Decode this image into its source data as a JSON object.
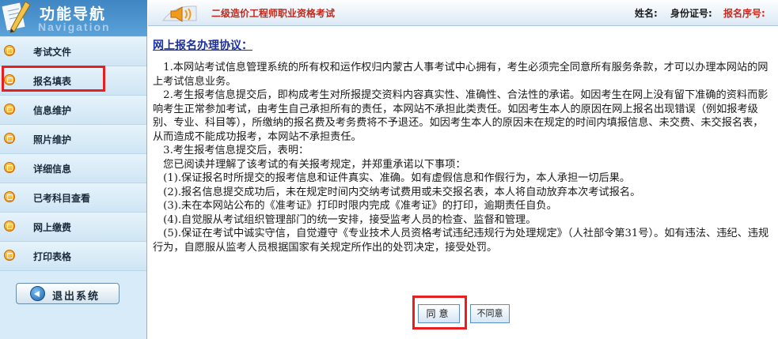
{
  "sidebar": {
    "title": "功能导航",
    "subtitle": "Navigation",
    "items": [
      {
        "label": "考试文件"
      },
      {
        "label": "报名填表"
      },
      {
        "label": "信息维护"
      },
      {
        "label": "照片维护"
      },
      {
        "label": "详细信息"
      },
      {
        "label": "已考科目查看"
      },
      {
        "label": "网上缴费"
      },
      {
        "label": "打印表格"
      }
    ],
    "logout_label": "退出系统"
  },
  "header": {
    "exam_title": "二级造价工程师职业资格考试",
    "name_label": "姓名:",
    "id_label": "身份证号:",
    "seq_label": "报名序号:"
  },
  "main": {
    "protocol_title": "网上报名办理协议：",
    "paragraphs": [
      "　1.本网站考试信息管理系统的所有权和运作权归内蒙古人事考试中心拥有，考生必须完全同意所有服务条款，才可以办理本网站的网上考试信息业务。",
      "　2.考生报考信息提交后，即构成考生对所报提交资料内容真实性、准确性、合法性的承诺。如因考生在网上没有留下准确的资料而影响考生正常参加考试，由考生自己承担所有的责任，本网站不承担此类责任。如因考生本人的原因在网上报名出现错误（例如报考级别、专业、科目等），所缴纳的报名费及考务费将不予退还。如因考生本人的原因未在规定的时间内填报信息、未交费、未交报名表，从而造成不能成功报考，本网站不承担责任。",
      "　3.考生报考信息提交后，表明：",
      "　您已阅读并理解了该考试的有关报考规定，并郑重承诺以下事项：",
      "　(1).保证报名时所提交的报考信息和证件真实、准确。如有虚假信息和作假行为，本人承担一切后果。",
      "　(2).报名信息提交成功后，未在规定时间内交纳考试费用或未交报名表，本人将自动放弃本次考试报名。",
      "　(3).未在本网站公布的《准考证》打印时限内完成《准考证》的打印，逾期责任自负。",
      "　(4).自觉服从考试组织管理部门的统一安排，接受监考人员的检查、监督和管理。",
      "　(5).保证在考试中诚实守信，自觉遵守《专业技术人员资格考试违纪违规行为处理规定》（人社部令第31号）。如有违法、违纪、违规行为，自愿服从监考人员根据国家有关规定所作出的处罚决定，接受处罚。"
    ],
    "agree_label": "同意",
    "disagree_label": "不同意"
  },
  "colors": {
    "highlight": "#e62020",
    "title_red": "#c0281a",
    "link_blue": "#1b2fa0",
    "sidebar_bg": "#d7ecf8"
  },
  "icons": [
    "pen-logo-icon",
    "announce-icon",
    "bullet-icon",
    "logout-arrow-icon"
  ]
}
